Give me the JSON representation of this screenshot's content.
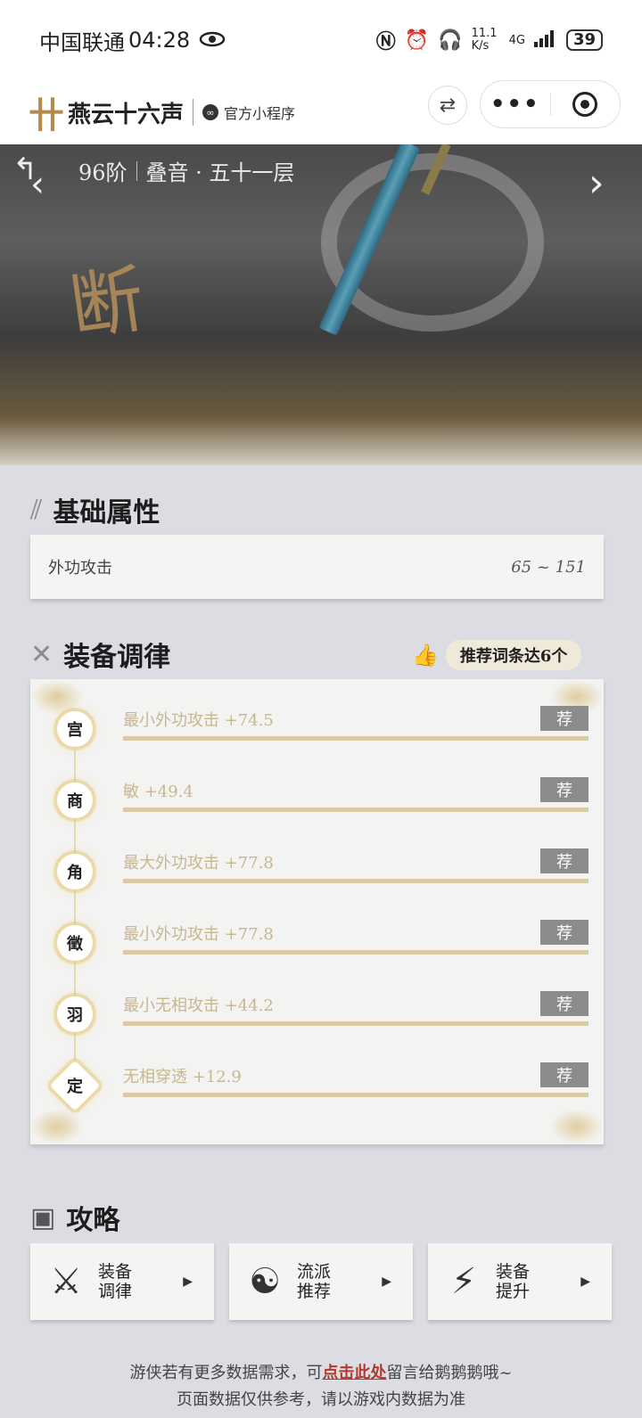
{
  "status_bar": {
    "carrier": "中国联通",
    "time": "04:28",
    "speed": "11.1 K/s",
    "network": "4G",
    "battery": "39"
  },
  "header": {
    "logo_text": "燕云十六声",
    "mini_program": "官方小程序"
  },
  "hero": {
    "tier": "96阶",
    "name": "叠音 · 五十一层",
    "calligraphy": "断"
  },
  "base_section": {
    "title": "基础属性",
    "attribute_label": "外功攻击",
    "attribute_value": "65 ~ 151"
  },
  "tune_section": {
    "title": "装备调律",
    "badge": "推荐词条达6个",
    "rows": [
      {
        "note": "宫",
        "text": "最小外功攻击 +74.5",
        "tag": "荐"
      },
      {
        "note": "商",
        "text": "敏 +49.4",
        "tag": "荐"
      },
      {
        "note": "角",
        "text": "最大外功攻击 +77.8",
        "tag": "荐"
      },
      {
        "note": "徵",
        "text": "最小外功攻击 +77.8",
        "tag": "荐"
      },
      {
        "note": "羽",
        "text": "最小无相攻击 +44.2",
        "tag": "荐"
      },
      {
        "note": "定",
        "text": "无相穿透 +12.9",
        "tag": "荐"
      }
    ]
  },
  "guide_section": {
    "title": "攻略",
    "buttons": [
      {
        "line1": "装备",
        "line2": "调律"
      },
      {
        "line1": "流派",
        "line2": "推荐"
      },
      {
        "line1": "装备",
        "line2": "提升"
      }
    ]
  },
  "footer": {
    "line1_prefix": "游侠若有更多数据需求，可",
    "line1_link": "点击此处",
    "line1_suffix": "留言给鹅鹅鹅哦~",
    "line2": "页面数据仅供参考，请以游戏内数据为准"
  }
}
